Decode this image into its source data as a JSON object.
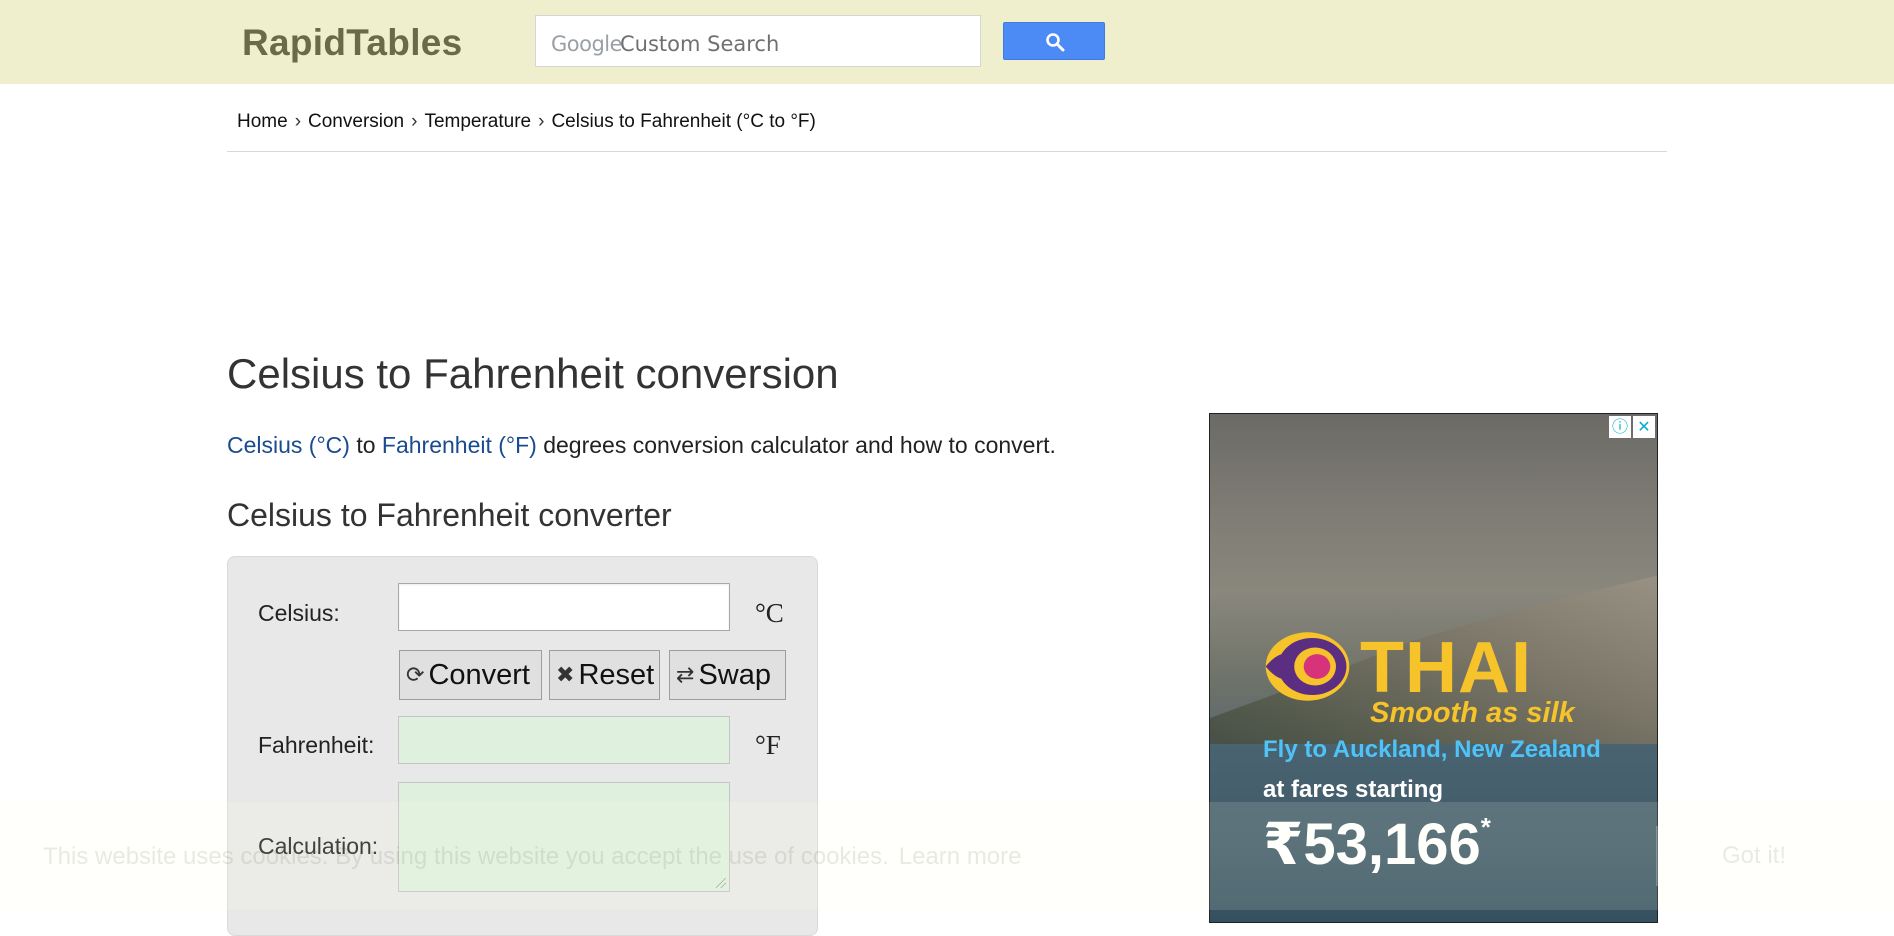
{
  "header": {
    "logo": "RapidTables",
    "search": {
      "brand": "Google",
      "placeholder": "Custom Search",
      "button_icon": "search-icon"
    }
  },
  "breadcrumb": {
    "items": [
      "Home",
      "Conversion",
      "Temperature"
    ],
    "current": "Celsius to Fahrenheit (°C to °F)",
    "separator": "›"
  },
  "main": {
    "title": "Celsius to Fahrenheit conversion",
    "intro": {
      "link1": "Celsius (°C)",
      "middle": " to ",
      "link2": "Fahrenheit (°F)",
      "rest": " degrees conversion calculator and how to convert."
    },
    "section_title": "Celsius to Fahrenheit converter",
    "converter": {
      "celsius_label": "Celsius:",
      "celsius_value": "",
      "celsius_unit": "°C",
      "buttons": {
        "convert": "Convert",
        "reset": "Reset",
        "swap": "Swap"
      },
      "fahrenheit_label": "Fahrenheit:",
      "fahrenheit_value": "",
      "fahrenheit_unit": "°F",
      "calculation_label": "Calculation:",
      "calculation_value": ""
    }
  },
  "ad": {
    "brand": "THAI",
    "tagline": "Smooth as silk",
    "line1": "Fly to Auckland, New Zealand",
    "line2": "at fares starting",
    "price": "₹53,166",
    "price_mark": "*",
    "info_icon": "info-icon",
    "close_icon": "close-icon"
  },
  "cookie_banner": {
    "text": "This website uses cookies. By using this website you accept the use of cookies.",
    "learn_more": "Learn more",
    "button": "Got it!"
  },
  "colors": {
    "header_bg": "#f0efcd",
    "logo": "#6a6a46",
    "search_button": "#4c8bf5",
    "link": "#1a4a8f",
    "output_field": "#dff0df",
    "ad_brand": "#f6c32a",
    "ad_line1": "#4fc3f7"
  }
}
